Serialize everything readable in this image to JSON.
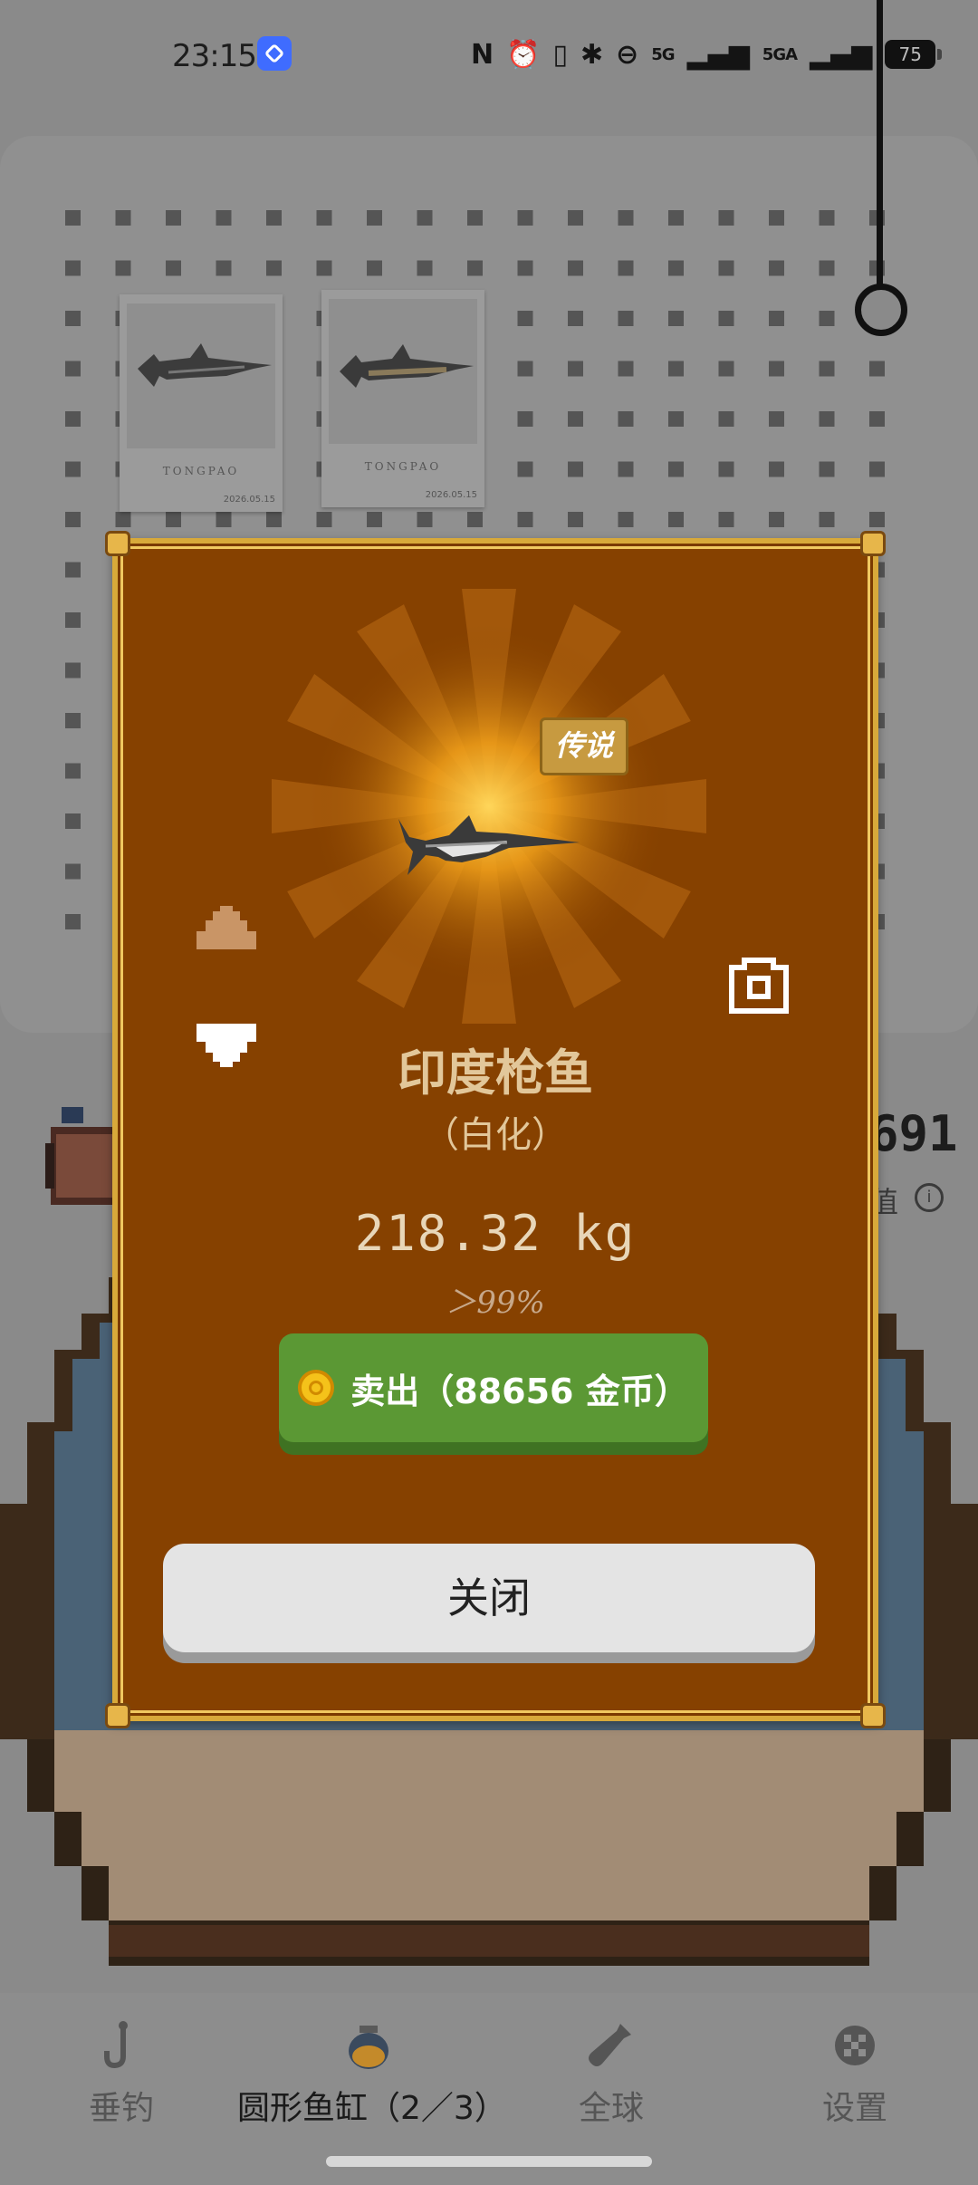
{
  "status_bar": {
    "time": "23:15",
    "signal_1": "5G",
    "signal_2": "5GA",
    "battery": "75"
  },
  "wall": {
    "posters": [
      {
        "brand": "TONGPAO",
        "date": "2026.05.15"
      },
      {
        "brand": "TONGPAO",
        "date": "2026.05.15"
      }
    ],
    "score": "691",
    "value_label": "值"
  },
  "dialog": {
    "rarity_badge": "传说",
    "fish_name": "印度枪鱼",
    "variant": "（白化）",
    "weight": "218.32 kg",
    "percentile": "＞99%",
    "sell_label": "卖出（88656 金币）",
    "close_label": "关闭"
  },
  "bottom_nav": {
    "items": [
      {
        "label": "垂钓",
        "icon": "fishing-hook-icon"
      },
      {
        "label": "圆形鱼缸（2／3）",
        "icon": "fishbowl-icon",
        "active": true
      },
      {
        "label": "全球",
        "icon": "bottle-icon"
      },
      {
        "label": "设置",
        "icon": "settings-icon"
      }
    ]
  },
  "colors": {
    "dialog_bg": "#864100",
    "dialog_border": "#d8a93a",
    "sell_button": "#5b9834",
    "close_button": "#e4e4e4"
  }
}
